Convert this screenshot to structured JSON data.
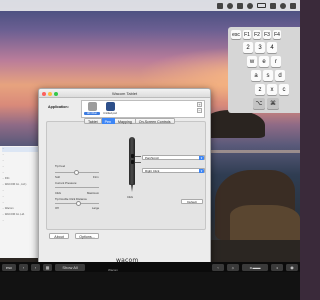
{
  "window": {
    "title": "Wacom Tablet"
  },
  "application": {
    "label": "Application:",
    "items": [
      {
        "name": "All Other",
        "selected": true,
        "color": "#9c9c9c"
      },
      {
        "name": "Untitled.psd",
        "selected": false,
        "color": "#2d4f8a"
      }
    ],
    "add": "+",
    "remove": "−"
  },
  "tabs": [
    {
      "label": "Tablet",
      "active": false
    },
    {
      "label": "Pen",
      "active": true
    },
    {
      "label": "Mapping",
      "active": false
    },
    {
      "label": "On-Screen Controls",
      "active": false
    }
  ],
  "pen": {
    "tip_feel": {
      "label": "Tip Feel",
      "min": "Soft",
      "max": "Firm",
      "value": 0.5
    },
    "current_pressure": "Current Pressure:",
    "click_label": "Click",
    "max_label": "Maximum",
    "double_click": {
      "label": "Tip Double Click Distance",
      "min": "Off",
      "max": "Large",
      "value": 0.55
    },
    "button_upper": "Pan/Scroll",
    "button_lower": "Right Click",
    "tip_action": "Click",
    "default_button": "Default"
  },
  "footer": {
    "about": "About",
    "options": "Options...",
    "brand": "wacom"
  },
  "touchbar": {
    "esc": "esc",
    "show_all": "Show All",
    "title": "Wacom"
  },
  "keyboard": {
    "rows": [
      [
        "esc",
        "F1",
        "F2",
        "F3",
        "F4"
      ],
      [
        "2",
        "3",
        "4"
      ],
      [
        "w",
        "e",
        "r"
      ],
      [
        "a",
        "s",
        "d"
      ],
      [
        "z",
        "x",
        "c"
      ],
      [
        "⌥",
        "⌘"
      ]
    ]
  },
  "left_window": {
    "rows": [
      "...",
      "...",
      "...",
      "...",
      "...",
      "... INC.",
      "... WACOM Co., Ltd.)",
      "...",
      "...",
      "...",
      "... Wacom",
      "... WACOM Co.,Ltd.",
      "..."
    ]
  }
}
